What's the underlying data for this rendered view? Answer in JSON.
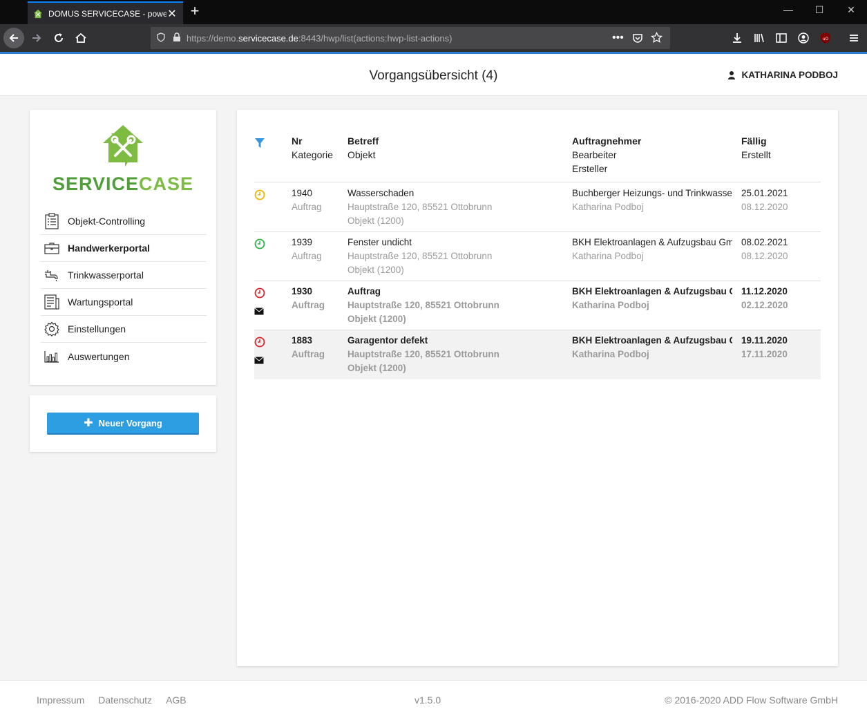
{
  "browser": {
    "tab_title": "DOMUS SERVICECASE - powere",
    "url_prefix": "https://demo.",
    "url_host": "servicecase.de",
    "url_rest": ":8443/hwp/list(actions:hwp-list-actions)"
  },
  "header": {
    "title": "Vorgangsübersicht (4)",
    "user": "KATHARINA PODBOJ"
  },
  "logo": {
    "part1": "SERVICE",
    "part2": "CASE"
  },
  "sidebar": {
    "items": [
      {
        "label": "Objekt-Controlling",
        "icon": "clipboard-icon",
        "active": false
      },
      {
        "label": "Handwerkerportal",
        "icon": "briefcase-icon",
        "active": true
      },
      {
        "label": "Trinkwasserportal",
        "icon": "faucet-icon",
        "active": false
      },
      {
        "label": "Wartungsportal",
        "icon": "document-icon",
        "active": false
      },
      {
        "label": "Einstellungen",
        "icon": "gear-icon",
        "active": false
      },
      {
        "label": "Auswertungen",
        "icon": "bar-chart-icon",
        "active": false
      }
    ],
    "new_button": "Neuer Vorgang"
  },
  "table": {
    "headers": {
      "nr": "Nr",
      "kategorie": "Kategorie",
      "betreff": "Betreff",
      "objekt": "Objekt",
      "auftragnehmer": "Auftragnehmer",
      "bearbeiter": "Bearbeiter",
      "ersteller": "Ersteller",
      "faellig": "Fällig",
      "erstellt": "Erstellt"
    },
    "rows": [
      {
        "nr": "1940",
        "kategorie": "Auftrag",
        "betreff": "Wasserschaden",
        "adresse": "Hauptstraße 120, 85521 Ottobrunn",
        "objekt": "Objekt (1200)",
        "auftragnehmer": "Buchberger Heizungs- und Trinkwasser ...",
        "bearbeiter": "Katharina Podboj",
        "faellig": "25.01.2021",
        "erstellt": "08.12.2020",
        "status_color": "#f0b400",
        "mail": false
      },
      {
        "nr": "1939",
        "kategorie": "Auftrag",
        "betreff": "Fenster undicht",
        "adresse": "Hauptstraße 120, 85521 Ottobrunn",
        "objekt": "Objekt (1200)",
        "auftragnehmer": "BKH Elektroanlagen & Aufzugsbau GmbH",
        "bearbeiter": "Katharina Podboj",
        "faellig": "08.02.2021",
        "erstellt": "08.12.2020",
        "status_color": "#2db24a",
        "mail": false
      },
      {
        "nr": "1930",
        "kategorie": "Auftrag",
        "betreff": "Auftrag",
        "adresse": "Hauptstraße 120, 85521 Ottobrunn",
        "objekt": "Objekt (1200)",
        "auftragnehmer": "BKH Elektroanlagen & Aufzugsbau GmbH",
        "bearbeiter": "Katharina Podboj",
        "faellig": "11.12.2020",
        "erstellt": "02.12.2020",
        "status_color": "#d9262c",
        "mail": true
      },
      {
        "nr": "1883",
        "kategorie": "Auftrag",
        "betreff": "Garagentor defekt",
        "adresse": "Hauptstraße 120, 85521 Ottobrunn",
        "objekt": "Objekt (1200)",
        "auftragnehmer": "BKH Elektroanlagen & Aufzugsbau GmbH",
        "bearbeiter": "Katharina Podboj",
        "faellig": "19.11.2020",
        "erstellt": "17.11.2020",
        "status_color": "#d9262c",
        "mail": true
      }
    ]
  },
  "footer": {
    "links": [
      "Impressum",
      "Datenschutz",
      "AGB"
    ],
    "version": "v1.5.0",
    "copyright": "© 2016-2020 ADD Flow Software GmbH"
  },
  "colors": {
    "accent": "#2e9ee2",
    "brand_green": "#4f9e3a"
  }
}
